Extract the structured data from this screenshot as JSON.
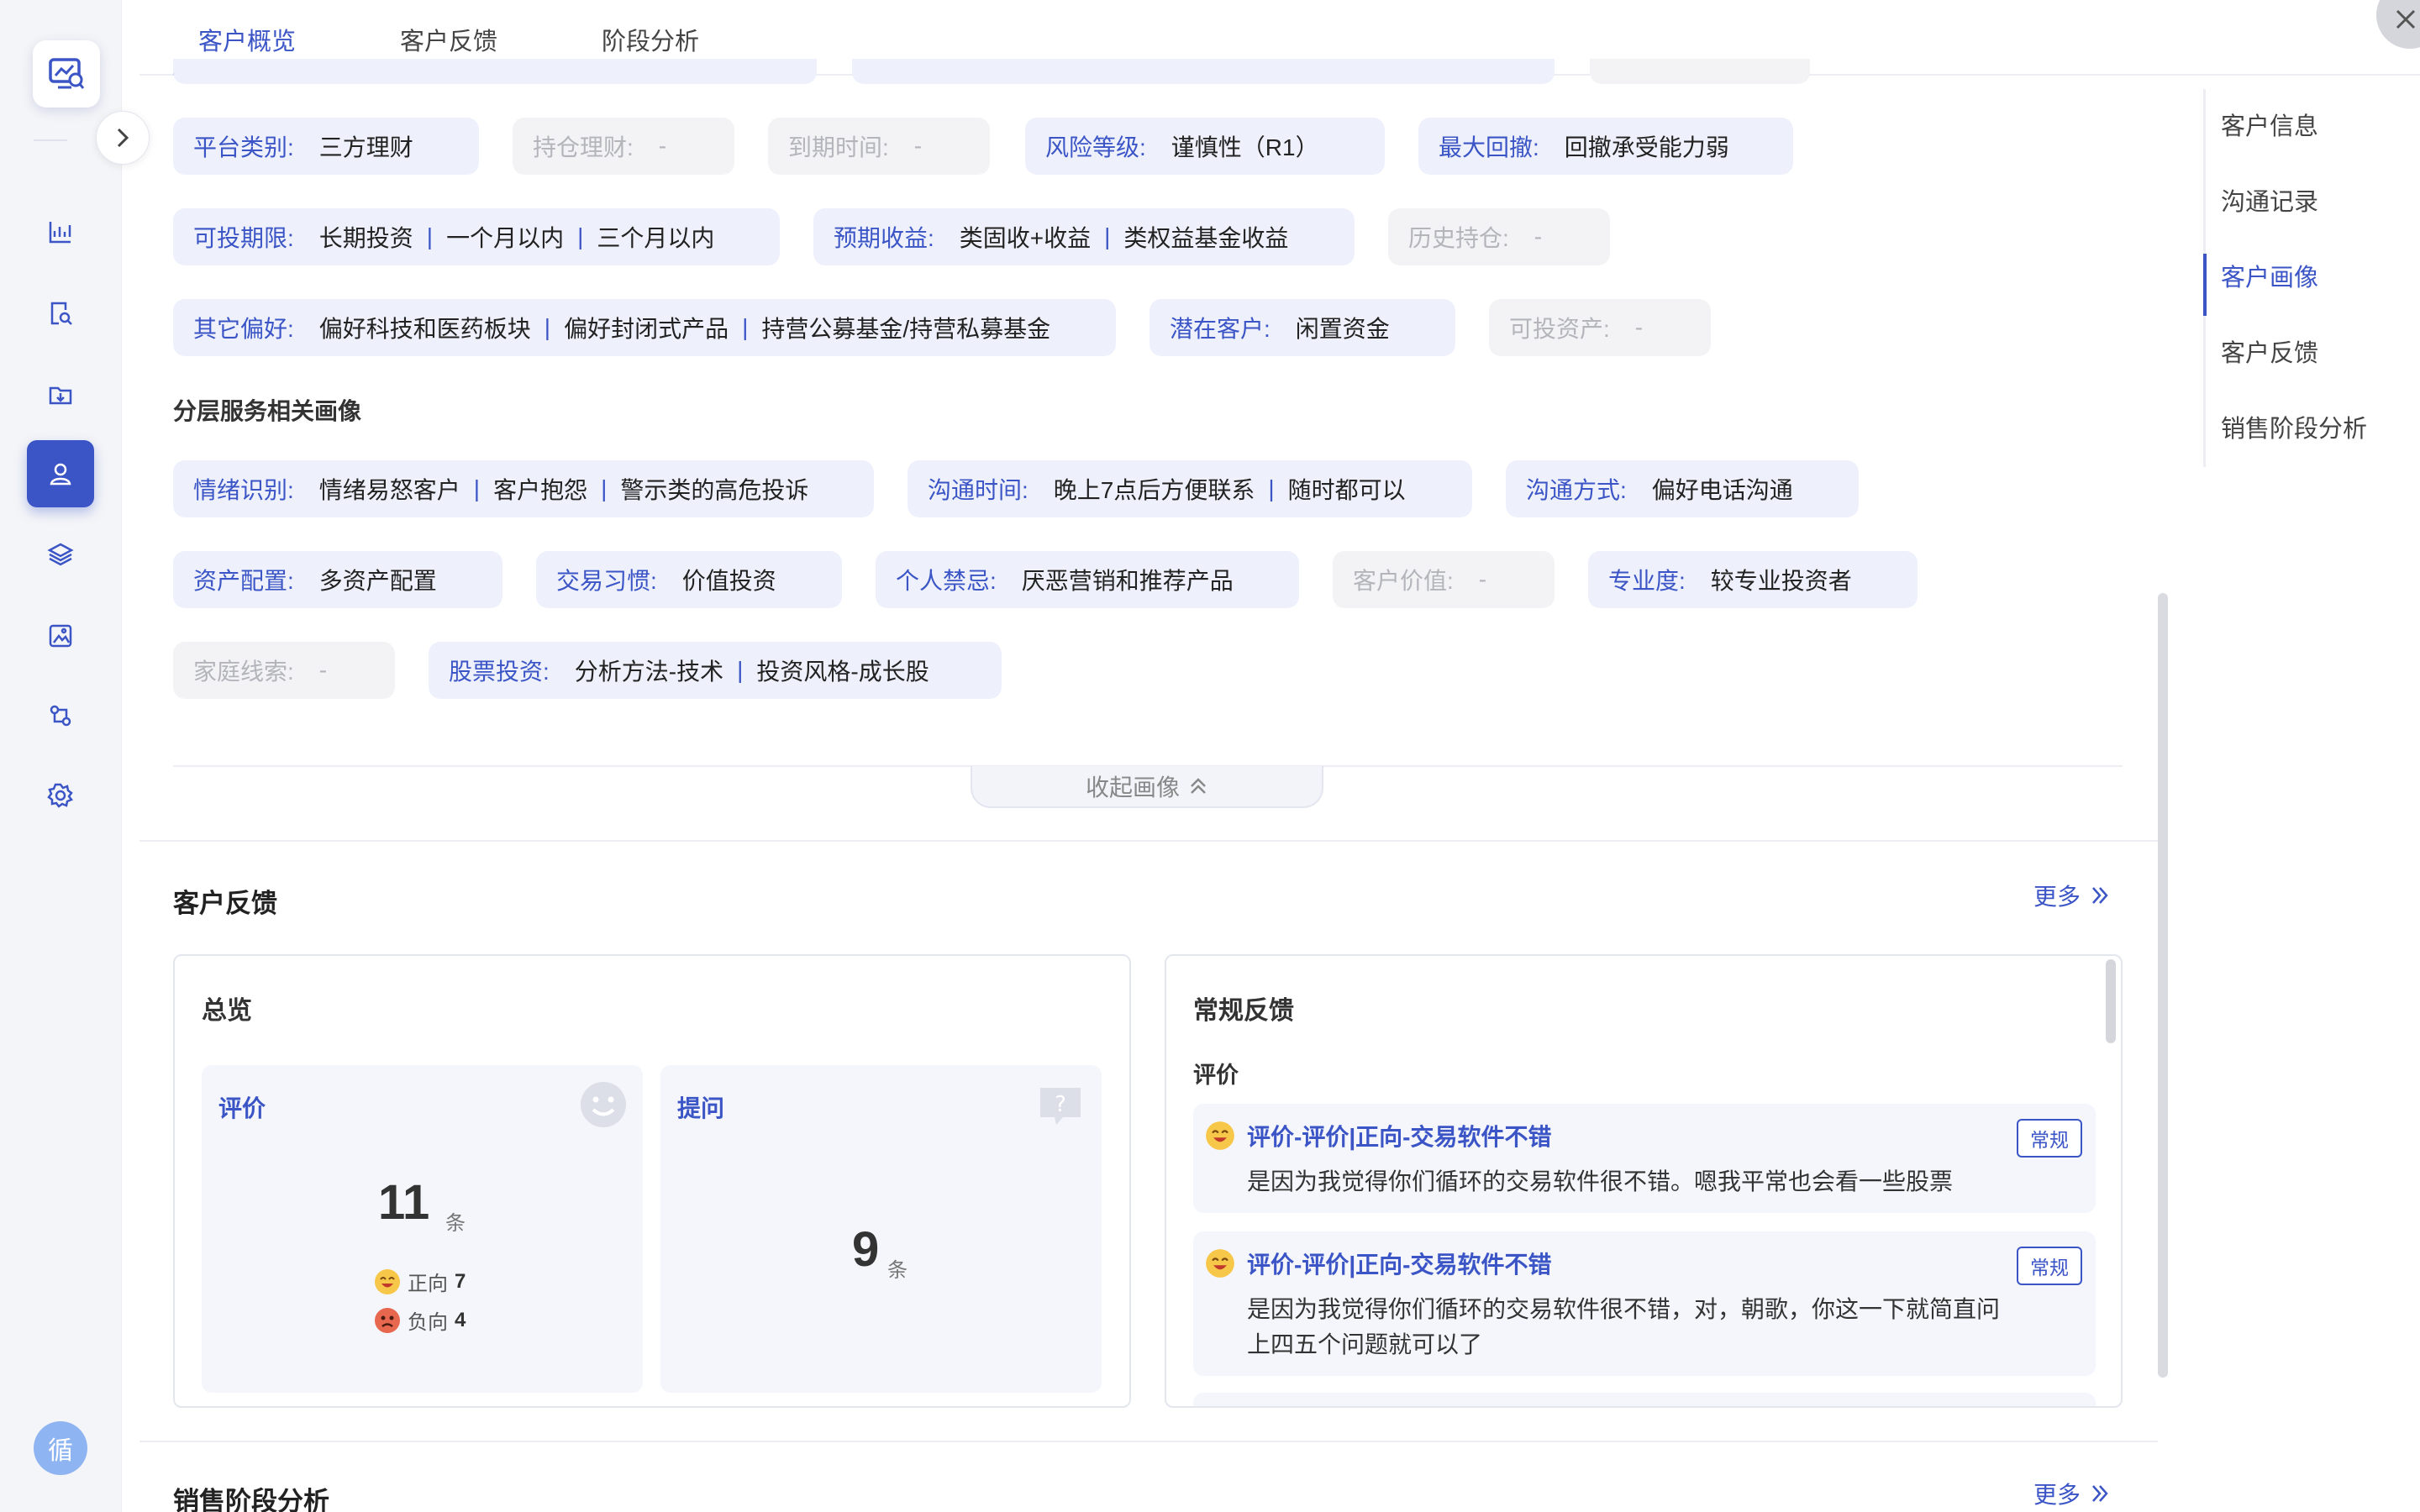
{
  "app": {
    "avatar_text": "循"
  },
  "tabs": [
    {
      "label": "客户概览",
      "active": true
    },
    {
      "label": "客户反馈",
      "active": false
    },
    {
      "label": "阶段分析",
      "active": false
    }
  ],
  "anchor_nav": [
    {
      "label": "客户信息"
    },
    {
      "label": "沟通记录"
    },
    {
      "label": "客户画像"
    },
    {
      "label": "客户反馈"
    },
    {
      "label": "销售阶段分析"
    }
  ],
  "portrait": {
    "row1": [
      {
        "key": "平台类别:",
        "value": "三方理财"
      },
      {
        "key": "持仓理财:",
        "value": "-"
      },
      {
        "key": "到期时间:",
        "value": "-"
      },
      {
        "key": "风险等级:",
        "value": "谨慎性（R1）"
      },
      {
        "key": "最大回撤:",
        "value": "回撤承受能力弱"
      }
    ],
    "row2": [
      {
        "key": "可投期限:",
        "values": [
          "长期投资",
          "一个月以内",
          "三个月以内"
        ]
      },
      {
        "key": "预期收益:",
        "values": [
          "类固收+收益",
          "类权益基金收益"
        ]
      },
      {
        "key": "历史持仓:",
        "value": "-"
      }
    ],
    "row3": [
      {
        "key": "其它偏好:",
        "values": [
          "偏好科技和医药板块",
          "偏好封闭式产品",
          "持营公募基金/持营私募基金"
        ]
      },
      {
        "key": "潜在客户:",
        "value": "闲置资金"
      },
      {
        "key": "可投资产:",
        "value": "-"
      }
    ],
    "layered_title": "分层服务相关画像",
    "row4": [
      {
        "key": "情绪识别:",
        "values": [
          "情绪易怒客户",
          "客户抱怨",
          "警示类的高危投诉"
        ]
      },
      {
        "key": "沟通时间:",
        "values": [
          "晚上7点后方便联系",
          "随时都可以"
        ]
      },
      {
        "key": "沟通方式:",
        "value": "偏好电话沟通"
      }
    ],
    "row5": [
      {
        "key": "资产配置:",
        "value": "多资产配置"
      },
      {
        "key": "交易习惯:",
        "value": "价值投资"
      },
      {
        "key": "个人禁忌:",
        "value": "厌恶营销和推荐产品"
      },
      {
        "key": "客户价值:",
        "value": "-"
      },
      {
        "key": "专业度:",
        "value": "较专业投资者"
      }
    ],
    "row6": [
      {
        "key": "家庭线索:",
        "value": "-"
      },
      {
        "key": "股票投资:",
        "values": [
          "分析方法-技术",
          "投资风格-成长股"
        ]
      }
    ],
    "separator": "|",
    "collapse_label": "收起画像"
  },
  "feedback": {
    "title": "客户反馈",
    "more_label": "更多",
    "overview": {
      "title": "总览",
      "rating": {
        "label": "评价",
        "count": "11",
        "unit": "条",
        "positive_label": "正向",
        "positive": "7",
        "negative_label": "负向",
        "negative": "4"
      },
      "question": {
        "label": "提问",
        "count": "9",
        "unit": "条"
      }
    },
    "regular": {
      "title": "常规反馈",
      "subtitle": "评价",
      "items": [
        {
          "title": "评价-评价|正向-交易软件不错",
          "tag": "常规",
          "body": "是因为我觉得你们循环的交易软件很不错。嗯我平常也会看一些股票"
        },
        {
          "title": "评价-评价|正向-交易软件不错",
          "tag": "常规",
          "body": "是因为我觉得你们循环的交易软件很不错，对，朝歌，你这一下就简直问上四五个问题就可以了"
        }
      ]
    }
  },
  "sales_stage": {
    "title": "销售阶段分析",
    "more_label": "更多"
  },
  "colors": {
    "accent": "#3b55c6",
    "chip_bg": "#eef1fb",
    "empty_chip_bg": "#f3f3f5"
  }
}
